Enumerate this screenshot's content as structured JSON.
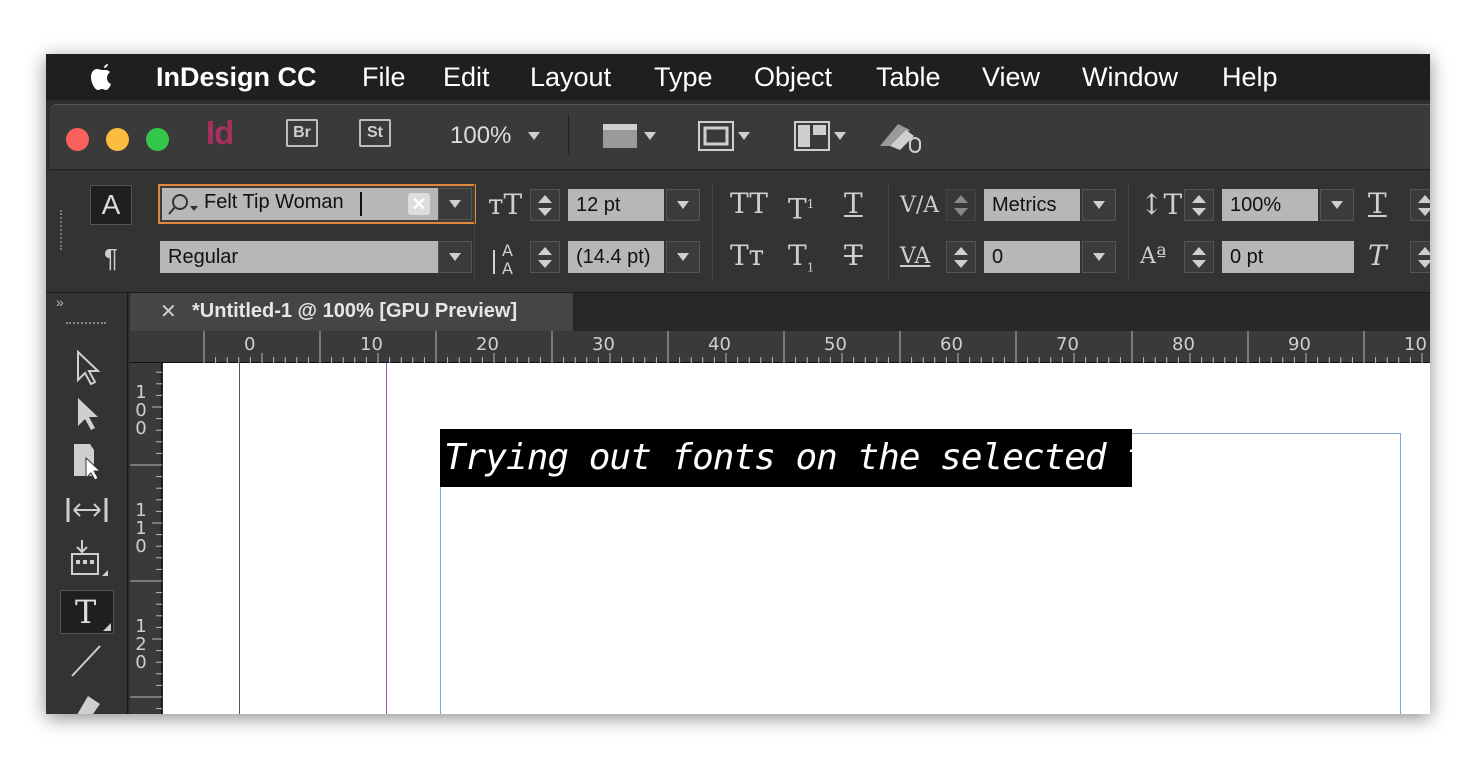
{
  "menubar": {
    "app_name": "InDesign CC",
    "items": [
      "File",
      "Edit",
      "Layout",
      "Type",
      "Object",
      "Table",
      "View",
      "Window",
      "Help"
    ]
  },
  "titlebar": {
    "app_badge": "Id",
    "bridge_label": "Br",
    "stock_label": "St",
    "zoom": "100%"
  },
  "control": {
    "font_family": "Felt Tip Woman",
    "font_style": "Regular",
    "font_size": "12 pt",
    "leading": "(14.4 pt)",
    "kerning": "Metrics",
    "tracking": "0",
    "vertical_scale": "100%",
    "baseline_shift": "0 pt"
  },
  "document": {
    "tab_title": "*Untitled-1 @ 100% [GPU Preview]",
    "selected_text": "Trying out fonts on the selected type"
  },
  "ruler": {
    "h_labels": [
      "0",
      "10",
      "20",
      "30",
      "40",
      "50",
      "60",
      "70",
      "80",
      "90",
      "10"
    ],
    "v_labels": [
      "100",
      "110",
      "120"
    ]
  },
  "colors": {
    "indesign_brand": "#a8305f",
    "close": "#fc605c",
    "minimize": "#fdbc40",
    "zoom": "#34c84a",
    "selection": "#000000"
  }
}
